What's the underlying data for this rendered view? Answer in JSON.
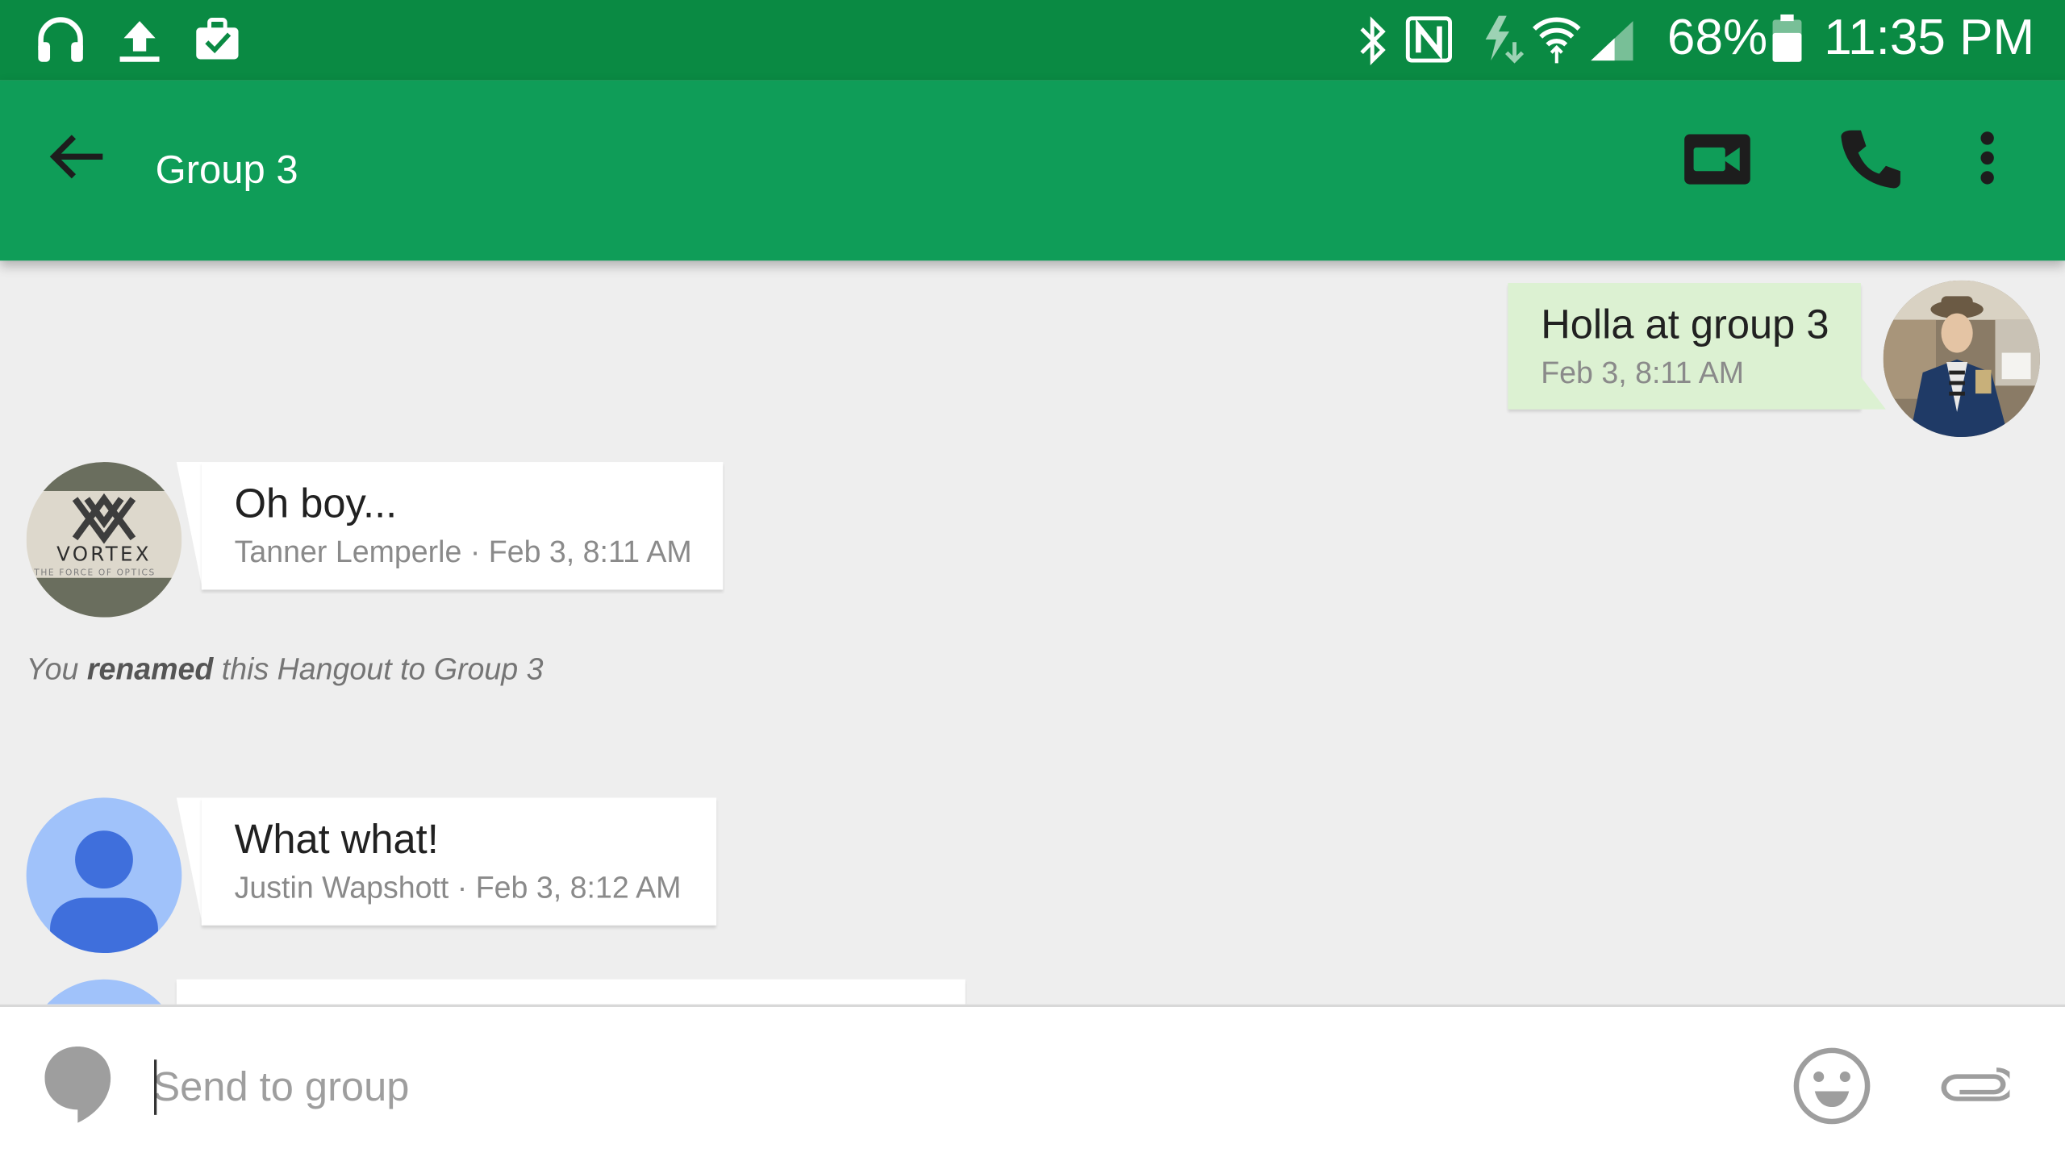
{
  "status_bar": {
    "battery": "68%",
    "time": "11:35 PM",
    "left_icons": [
      "headphones-icon",
      "upload-icon",
      "briefcase-icon"
    ],
    "right_icons": [
      "bluetooth-icon",
      "nfc-icon",
      "data-saver-icon",
      "wifi-icon",
      "signal-icon",
      "battery-icon"
    ]
  },
  "app_bar": {
    "title": "Group 3",
    "actions": [
      "video-call-icon",
      "phone-icon",
      "more-vert-icon"
    ],
    "color": "#0f9d58"
  },
  "messages": [
    {
      "text": "Holla at group 3",
      "meta": "Feb 3, 8:11 AM",
      "own": true
    },
    {
      "text": "Oh boy...",
      "meta": "Tanner Lemperle · Feb 3, 8:11 AM",
      "own": false
    },
    {
      "text": "What what!",
      "meta": "Justin Wapshott · Feb 3, 8:12 AM",
      "own": false
    }
  ],
  "system_message": {
    "prefix": "You",
    "action": "renamed",
    "suffix": "this Hangout to Group 3"
  },
  "avatars": {
    "vortex_logo_text": "VORTEX",
    "vortex_tagline": "THE FORCE OF OPTICS"
  },
  "composer": {
    "placeholder": "Send to group",
    "value": ""
  }
}
